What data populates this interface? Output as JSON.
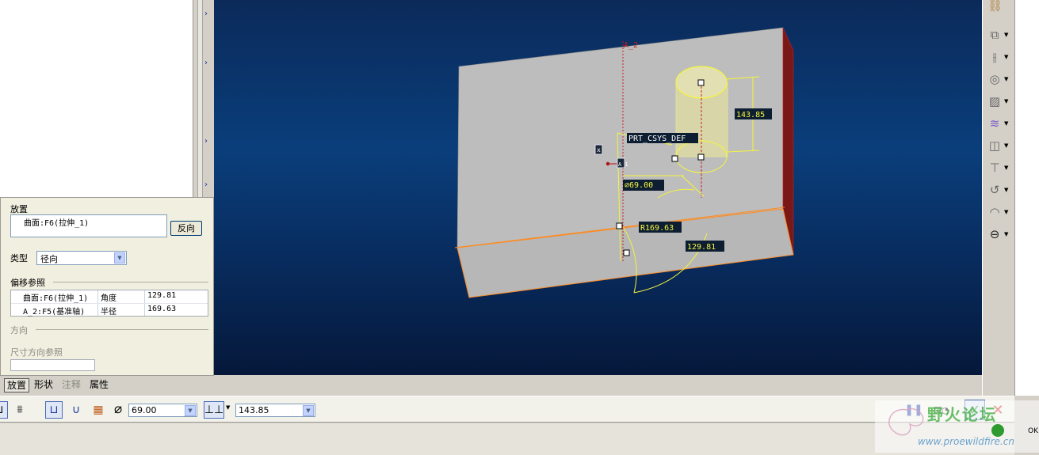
{
  "viewport": {
    "axis_label": "A_2",
    "csys_label": "PRT_CSYS_DEF",
    "axis_tag": "A_1",
    "x_tag": "x",
    "dim_height": "143.85",
    "dim_diameter": "⌀69.00",
    "dim_radius": "R169.63",
    "dim_angle": "129.81"
  },
  "panel": {
    "placement_title": "放置",
    "surface_ref": "曲面:F6(拉伸_1)",
    "flip_label": "反向",
    "type_label": "类型",
    "type_value": "径向",
    "offset_title": "偏移参照",
    "offset_rows": [
      {
        "ref": "曲面:F6(拉伸_1)",
        "kind": "角度",
        "value": "129.81"
      },
      {
        "ref": "A_2:F5(基准轴)",
        "kind": "半径",
        "value": "169.63"
      }
    ],
    "direction_title": "方向",
    "dim_dir_ref_label": "尺寸方向参照"
  },
  "tabs": [
    "放置",
    "形状",
    "注释",
    "属性"
  ],
  "dashboard": {
    "diameter_value": "69.00",
    "depth_value": "143.85"
  },
  "watermark": {
    "text": "野火论坛",
    "url": "www.proewildfire.cn",
    "ok": "OK"
  },
  "colors": {
    "part_face": "#bdbdbd",
    "dimension": "#f5f53c",
    "edge_highlight": "#ff8a1e",
    "accept": "#2f8f2f",
    "cancel": "#d62020"
  }
}
